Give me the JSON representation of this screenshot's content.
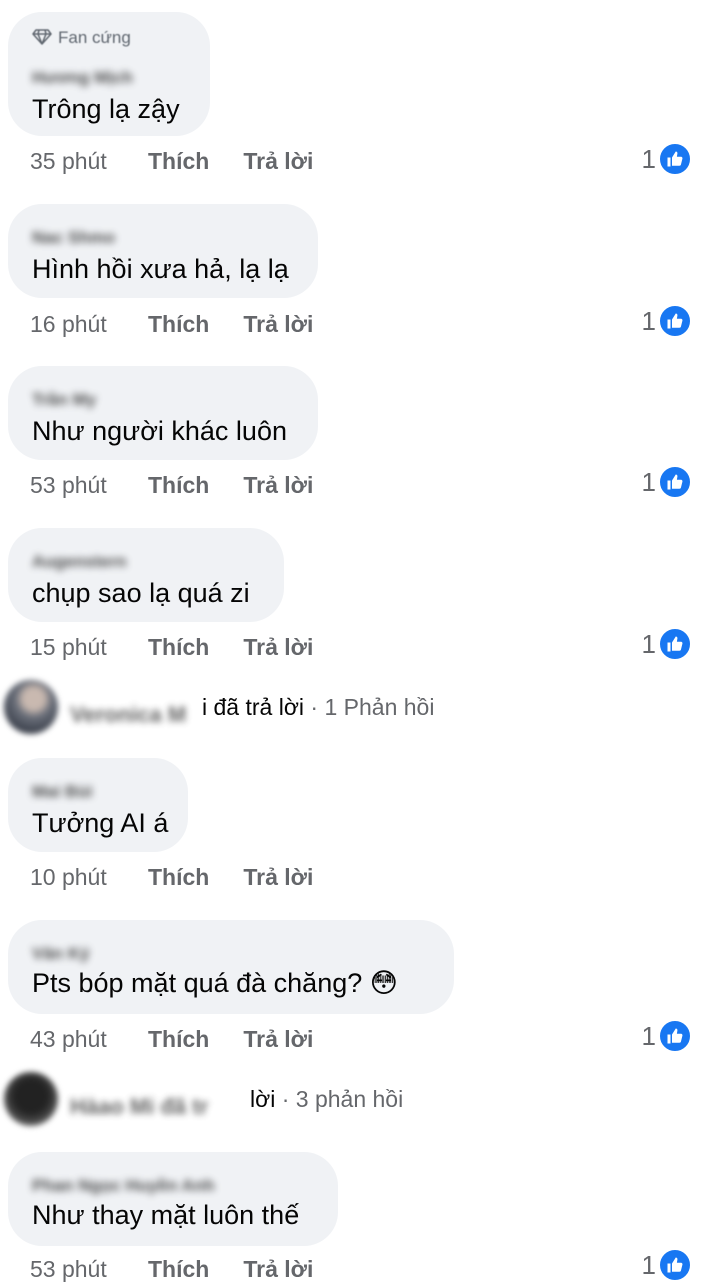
{
  "actions": {
    "like_label": "Thích",
    "reply_label": "Trả lời"
  },
  "comments": [
    {
      "badge": "Fan cứng",
      "author": "Hương Mịch",
      "text": "Trông lạ zậy",
      "time": "35 phút",
      "likes": "1"
    },
    {
      "author": "Nac Shmo",
      "text": "Hình hồi xưa hả, lạ lạ",
      "time": "16 phút",
      "likes": "1"
    },
    {
      "author": "Trần My",
      "text": "Như người khác luôn",
      "time": "53 phút",
      "likes": "1"
    },
    {
      "author": "Augenstern",
      "text": "chụp sao lạ quá zi",
      "time": "15 phút",
      "likes": "1"
    },
    {
      "author": "Mai Bùi",
      "text": "Tưởng AI á",
      "time": "10 phút",
      "likes": ""
    },
    {
      "author": "Văn Ký",
      "text": "Pts bóp mặt quá đà chăng? 😳",
      "time": "43 phút",
      "likes": "1"
    },
    {
      "author": "Phan Ngọc Huyền Anh",
      "text": "Như thay mặt luôn thế",
      "time": "53 phút",
      "likes": "1"
    }
  ],
  "reply_threads": [
    {
      "name": "Veronica M",
      "visible": "i đã trả lời",
      "count": "1 Phản hồi"
    },
    {
      "name": "Hàao Mi đã tr",
      "visible": "lời",
      "count": "3 phản hồi"
    }
  ],
  "colors": {
    "bubble": "#f0f2f5",
    "like_blue": "#1877f2",
    "meta_gray": "#65676b"
  },
  "icons": {
    "badge": "diamond-icon",
    "reaction": "thumbs-up-icon"
  }
}
